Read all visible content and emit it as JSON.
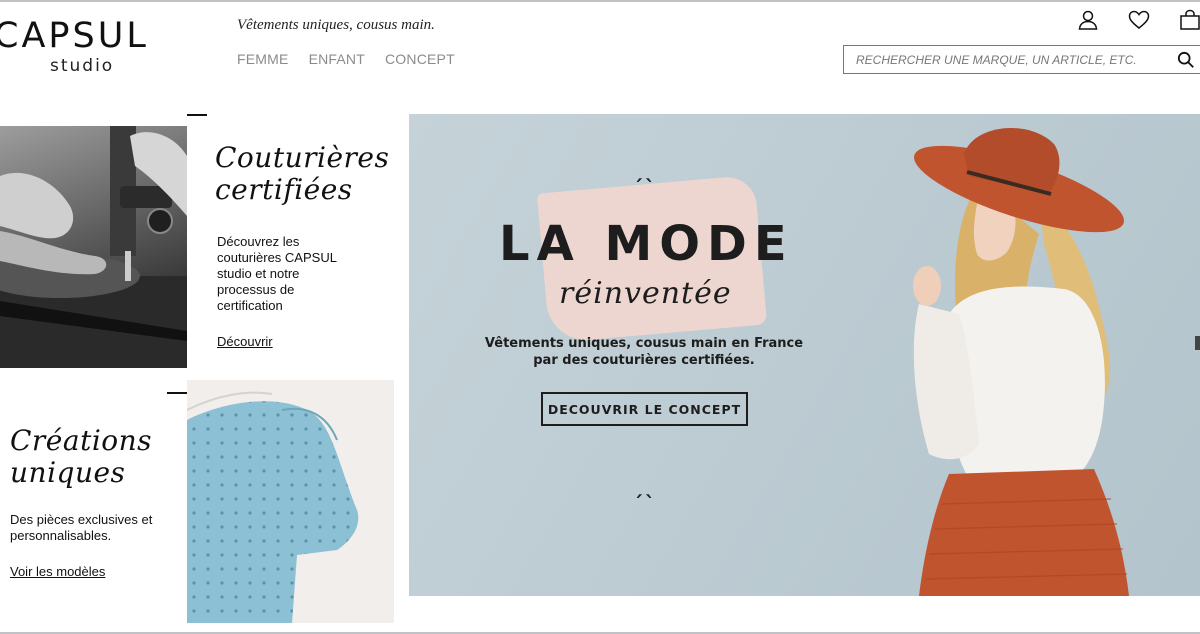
{
  "brand": {
    "name": "CAPSUL",
    "sub": "studio"
  },
  "tagline": "Vêtements uniques, cousus main.",
  "nav": [
    {
      "label": "FEMME"
    },
    {
      "label": "ENFANT"
    },
    {
      "label": "CONCEPT"
    }
  ],
  "header_icons": [
    "user-icon",
    "heart-icon",
    "shopping-bag-icon"
  ],
  "search": {
    "placeholder": "RECHERCHER UNE MARQUE, UN ARTICLE, ETC."
  },
  "tiles": [
    {
      "title_line1": "Couturières",
      "title_line2": "certifiées",
      "text": "Découvrez les couturières CAPSUL studio et notre processus de certification",
      "link": "Découvrir"
    },
    {
      "title_line1": "Créations",
      "title_line2": "uniques",
      "text": "Des pièces exclusives et personnalisables.",
      "link": "Voir les modèles"
    }
  ],
  "hero": {
    "title": "LA MODE",
    "script": "réinventée",
    "subtitle_line1": "Vêtements uniques, cousus main en France",
    "subtitle_line2": "par des couturières certifiées.",
    "button": "DECOUVRIR LE CONCEPT",
    "quote_open": "ˏˎ",
    "quote_close": "ˏˎ"
  },
  "colors": {
    "hero_bg": "#bccbd2",
    "brush": "#f0d6d0",
    "hat": "#c0542f",
    "skirt": "#c0542f",
    "dress_blue": "#7fb4c9"
  }
}
